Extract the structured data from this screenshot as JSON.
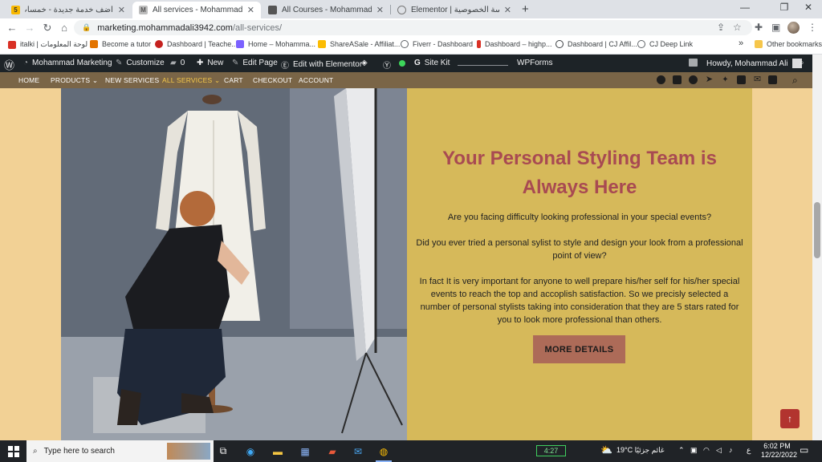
{
  "tabs": [
    {
      "title": "أضف خدمة جديدة - خمسات",
      "fav": "5",
      "fav_color": "#f9b800",
      "active": false
    },
    {
      "title": "All services - Mohammad Marketi",
      "fav": "M",
      "fav_color": "#8a8a8a",
      "active": true
    },
    {
      "title": "All Courses - Mohammad Tutor",
      "fav": "",
      "fav_color": "#555555",
      "active": false
    },
    {
      "title": "Elementor | سياسة الخصوصية",
      "fav": "",
      "fav_color": "#777777",
      "active": false
    }
  ],
  "window": {
    "minimize": "—",
    "restore": "❐",
    "close": "✕",
    "newtab": "+"
  },
  "address": {
    "host": "marketing.mohammadali3942.com",
    "path": "/all-services/"
  },
  "bookmarks": [
    {
      "label": "italki | لوحة المعلومات",
      "color": "#d93025"
    },
    {
      "label": "Become a tutor",
      "color": "#e37400"
    },
    {
      "label": "Dashboard | Teache...",
      "color": "#c5221f"
    },
    {
      "label": "Home – Mohamma...",
      "color": "#7b61ff"
    },
    {
      "label": "ShareASale - Affiliat...",
      "color": "#fbbc04"
    },
    {
      "label": "Fiverr - Dashboard",
      "color": "#5f6368"
    },
    {
      "label": "Dashboard – highp...",
      "color": "#d93025"
    },
    {
      "label": "Dashboard | CJ Affil...",
      "color": "#5f6368"
    },
    {
      "label": "CJ Deep Link",
      "color": "#5f6368"
    }
  ],
  "bookmarks_more": "»",
  "bookmarks_other": "Other bookmarks",
  "wpbar": {
    "site": "Mohammad Marketing",
    "customize": "Customize",
    "comments": "0",
    "new": "New",
    "edit_page": "Edit Page",
    "elementor": "Edit with Elementor",
    "sitekit": "Site Kit",
    "wpforms": "WPForms",
    "howdy": "Howdy, Mohammad Ali"
  },
  "nav": {
    "home": "HOME",
    "products": "PRODUCTS",
    "new_services": "NEW SERVICES",
    "all_services": "ALL SERVICES",
    "cart": "CART",
    "checkout": "CHECKOUT",
    "account": "ACCOUNT"
  },
  "hero": {
    "headline": "Your Personal Styling Team is Always Here",
    "p1": "Are you facing difficulty looking professional in your special events?",
    "p2": "Did you ever tried a personal sylist to style and design your look from a professional point of view?",
    "p3": "In fact It is very important for anyone to well prepare his/her self for his/her special events to reach the top and accoplish satisfaction. So we precisly selected a number of personal stylists taking into consideration that they are 5 stars rated for you to look more professional than others.",
    "button": "MORE DETAILS"
  },
  "taskbar": {
    "search_placeholder": "Type here to search",
    "battery": "4:27",
    "weather": "19°C  غائم جزئيًا",
    "lang": "ع",
    "time": "6:02 PM",
    "date": "12/22/2022"
  }
}
